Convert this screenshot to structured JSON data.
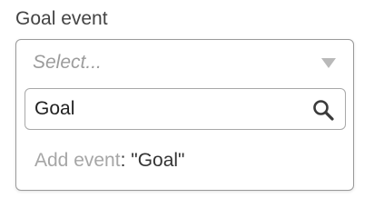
{
  "field": {
    "label": "Goal event",
    "placeholder": "Select..."
  },
  "search": {
    "value": "Goal"
  },
  "option": {
    "prefix": "Add event",
    "value_text": ": \"Goal\""
  },
  "icons": {
    "caret": "chevron-down-icon",
    "search": "search-icon"
  }
}
